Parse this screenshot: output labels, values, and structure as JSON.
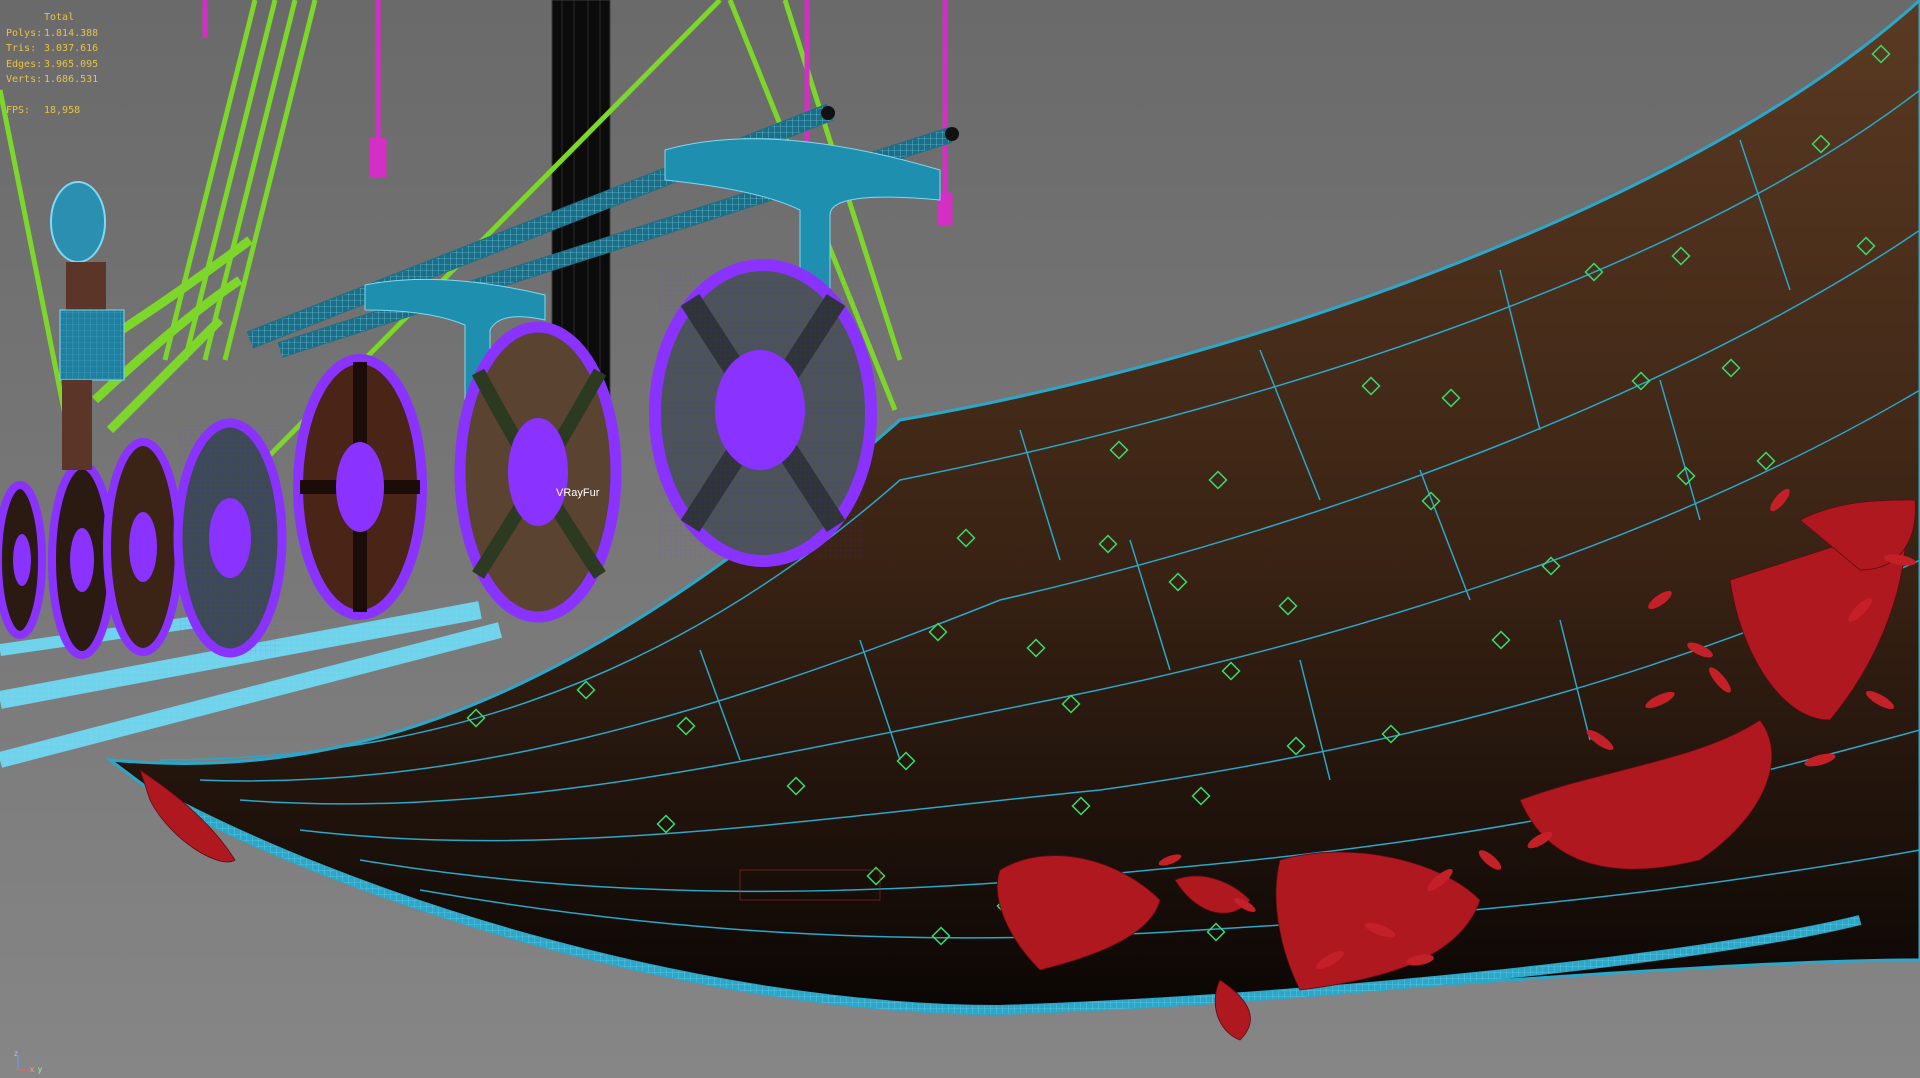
{
  "stats": {
    "header": "Total",
    "polys_label": "Polys:",
    "polys_value": "1.814.388",
    "tris_label": "Tris:",
    "tris_value": "3.037.616",
    "edges_label": "Edges:",
    "edges_value": "3.965.095",
    "verts_label": "Verts:",
    "verts_value": "1.686.531",
    "fps_label": "FPS:",
    "fps_value": "18,958"
  },
  "object_label": "VRayFur",
  "axis": {
    "z": "z",
    "x": "x",
    "y": "y"
  },
  "colors": {
    "stats_text": "#e9c341",
    "hull_wire": "#2aa7c9",
    "shield_wire": "#8a32ff",
    "rope_green": "#7dd62a",
    "rope_magenta": "#d42fc4",
    "fur_red": "#b01820",
    "rivet_green": "#39d96c"
  }
}
